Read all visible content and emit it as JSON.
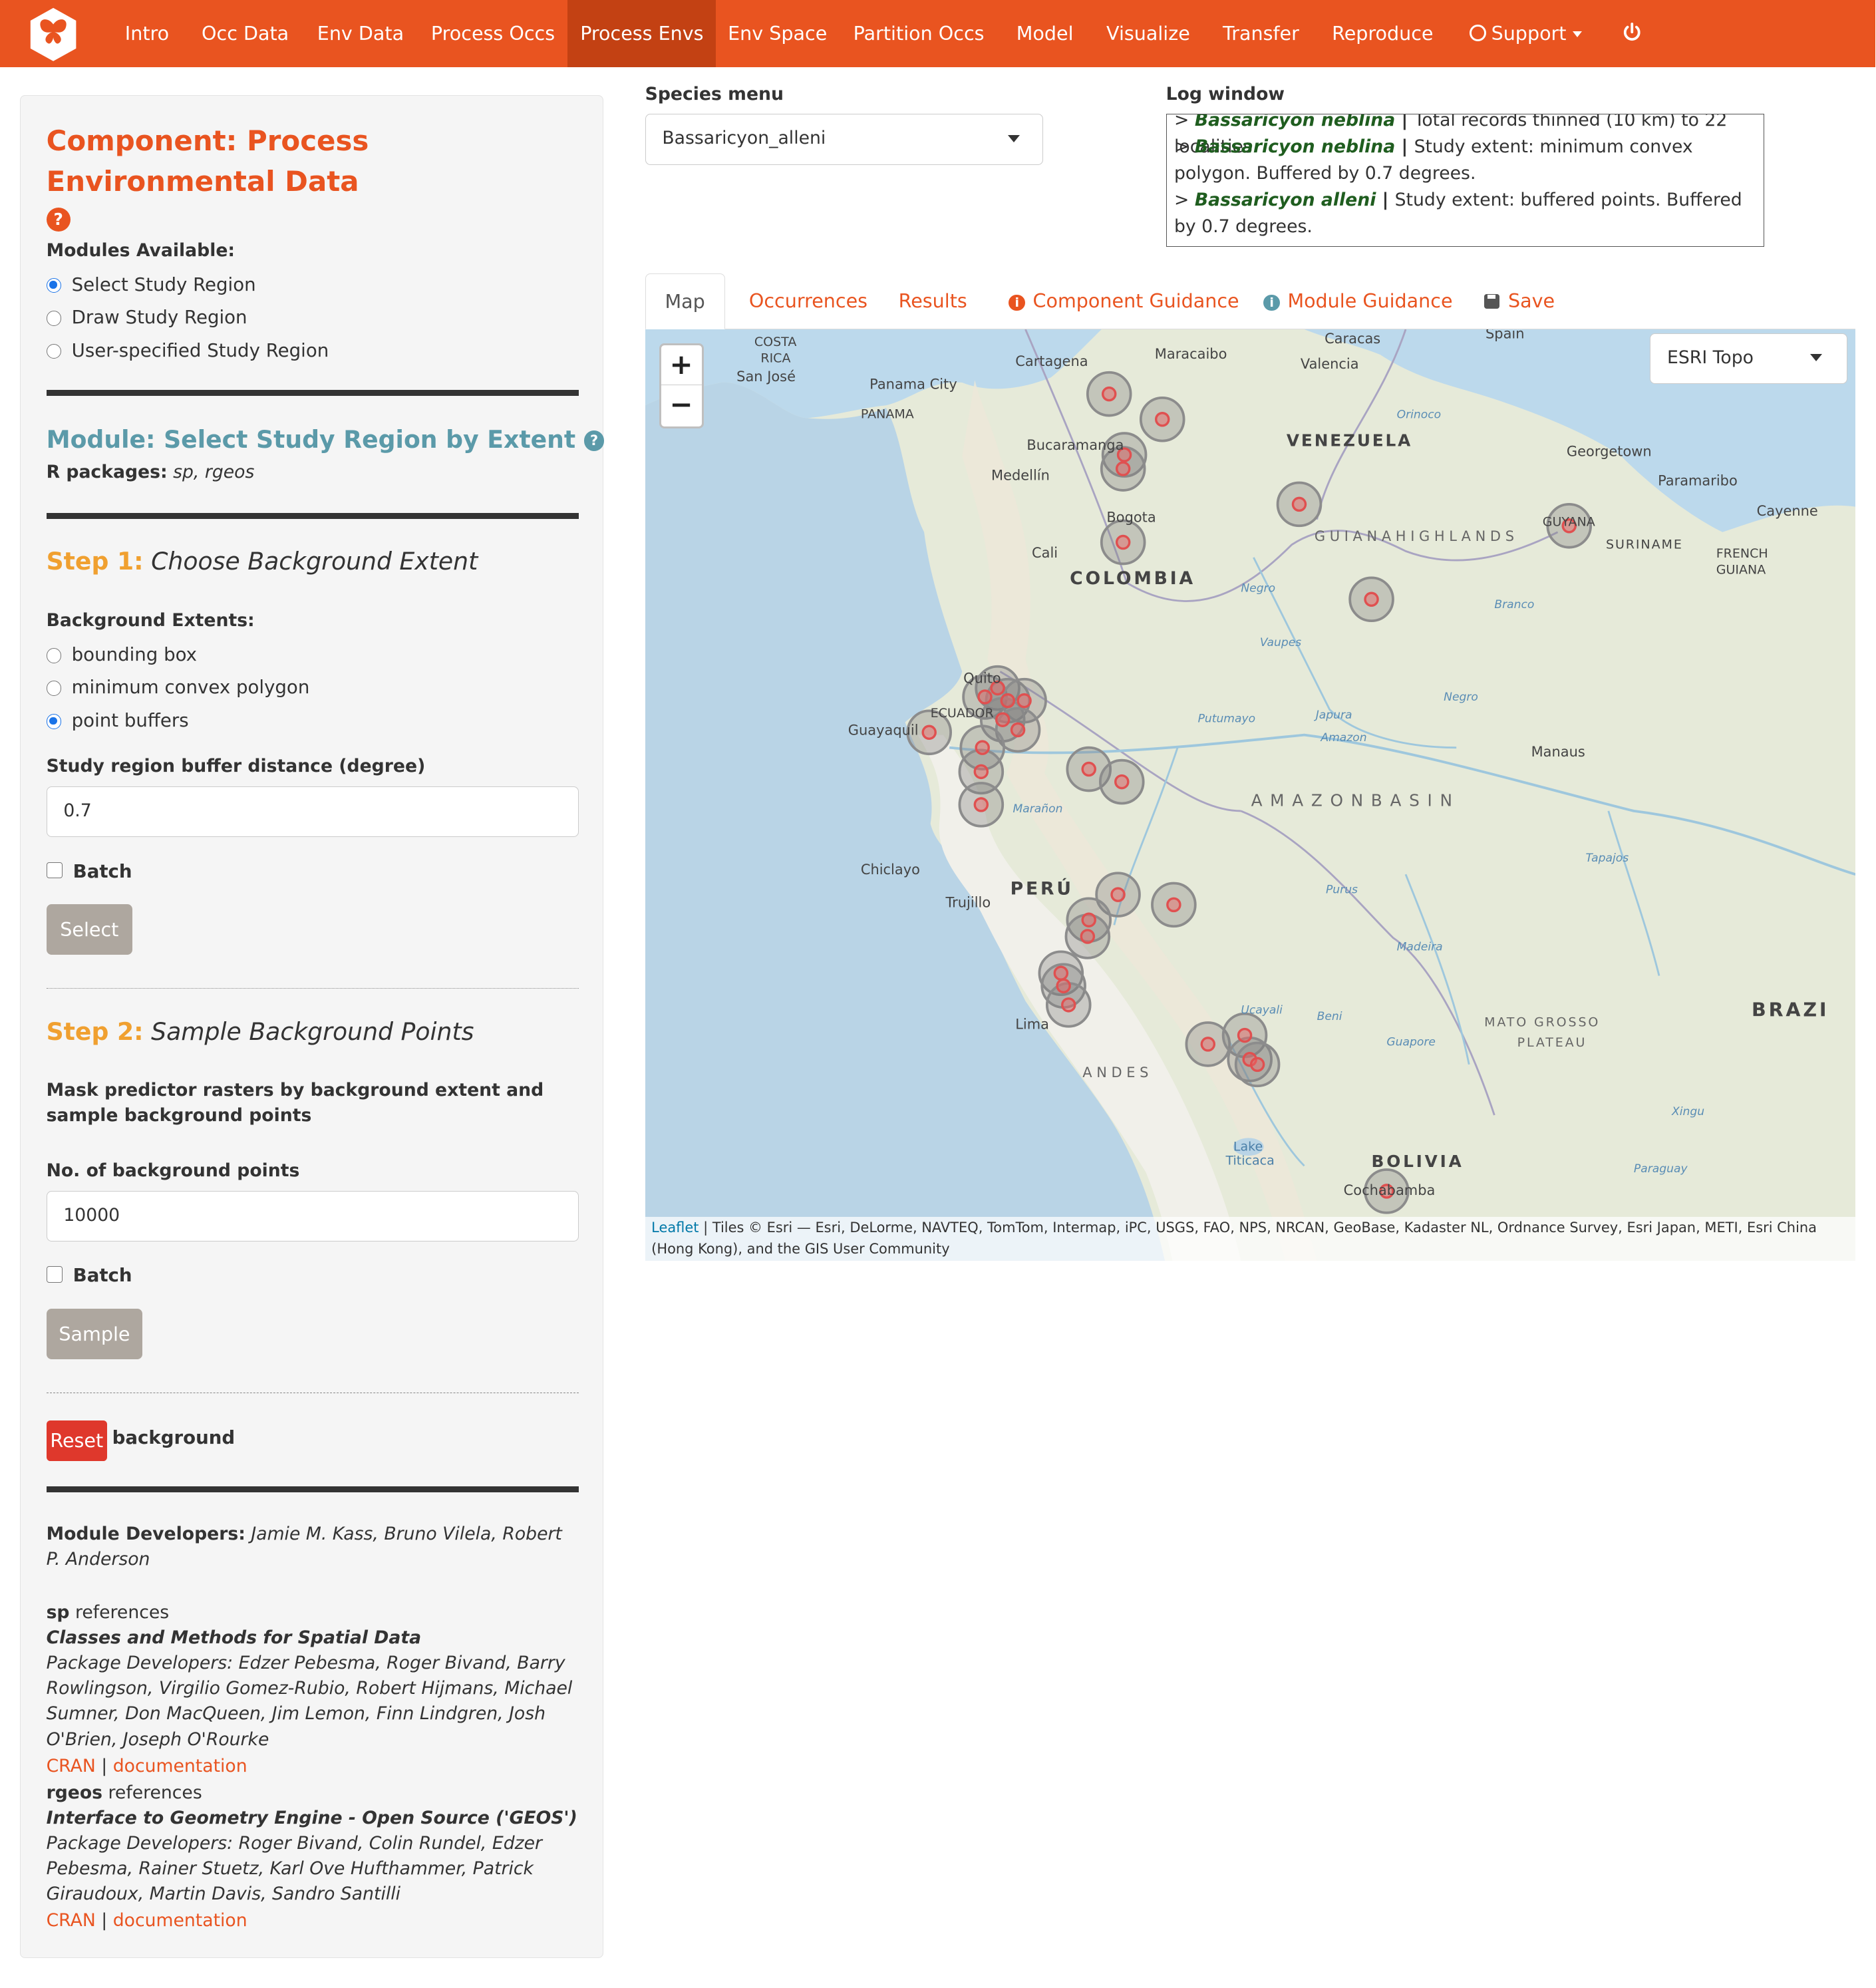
{
  "navbar": {
    "items": [
      "Intro",
      "Occ Data",
      "Env Data",
      "Process Occs",
      "Process Envs",
      "Env Space",
      "Partition Occs",
      "Model",
      "Visualize",
      "Transfer",
      "Reproduce",
      "Support"
    ],
    "active": "Process Envs",
    "brand_color": "#e95420",
    "active_color": "#c34113"
  },
  "sidebar": {
    "component_title": "Component: Process Environmental Data",
    "modules_label": "Modules Available:",
    "modules": [
      {
        "label": "Select Study Region",
        "selected": true
      },
      {
        "label": "Draw Study Region",
        "selected": false
      },
      {
        "label": "User-specified Study Region",
        "selected": false
      }
    ],
    "module_title": "Module: Select Study Region by Extent",
    "r_packages_label": "R packages:",
    "r_packages": "sp, rgeos",
    "step1_num": "Step 1:",
    "step1_title": "Choose Background Extent",
    "extents_label": "Background Extents:",
    "extents": [
      {
        "label": "bounding box",
        "selected": false
      },
      {
        "label": "minimum convex polygon",
        "selected": false
      },
      {
        "label": "point buffers",
        "selected": true
      }
    ],
    "buffer_label": "Study region buffer distance (degree)",
    "buffer_value": "0.7",
    "batch_label": "Batch",
    "select_button": "Select",
    "step2_num": "Step 2:",
    "step2_title": "Sample Background Points",
    "mask_text": "Mask predictor rasters by background extent and sample background points",
    "bg_points_label": "No. of background points",
    "bg_points_value": "10000",
    "batch2_label": "Batch",
    "sample_button": "Sample",
    "reset_button": "Reset",
    "reset_suffix": "background",
    "developers_label": "Module Developers:",
    "developers": "Jamie M. Kass, Bruno Vilela, Robert P. Anderson",
    "refs": [
      {
        "pkg": "sp",
        "suffix": "references",
        "title": "Classes and Methods for Spatial Data",
        "devs": "Package Developers: Edzer Pebesma, Roger Bivand, Barry Rowlingson, Virgilio Gomez-Rubio, Robert Hijmans, Michael Sumner, Don MacQueen, Jim Lemon, Finn Lindgren, Josh O'Brien, Joseph O'Rourke",
        "cran": "CRAN",
        "sep": "|",
        "doc": "documentation"
      },
      {
        "pkg": "rgeos",
        "suffix": "references",
        "title": "Interface to Geometry Engine - Open Source ('GEOS')",
        "devs": "Package Developers: Roger Bivand, Colin Rundel, Edzer Pebesma, Rainer Stuetz, Karl Ove Hufthammer, Patrick Giraudoux, Martin Davis, Sandro Santilli",
        "cran": "CRAN",
        "sep": "|",
        "doc": "documentation"
      }
    ]
  },
  "species_menu": {
    "label": "Species menu",
    "value": "Bassaricyon_alleni"
  },
  "log_window": {
    "label": "Log window",
    "lines": [
      {
        "prefix": "> ",
        "species": "Bassaricyon neblina",
        "bar": " | ",
        "text": "Total records thinned (10 km) to 22 localities"
      },
      {
        "prefix": "> ",
        "species": "Bassaricyon neblina",
        "bar": " | ",
        "text": "Study extent: minimum convex polygon. Buffered by 0.7 degrees."
      },
      {
        "prefix": "> ",
        "species": "Bassaricyon alleni",
        "bar": " | ",
        "text": "Study extent: buffered points. Buffered by 0.7 degrees."
      }
    ]
  },
  "tabs": [
    {
      "label": "Map",
      "icon": "",
      "active": true
    },
    {
      "label": "Occurrences",
      "icon": "",
      "active": false
    },
    {
      "label": "Results",
      "icon": "",
      "active": false
    },
    {
      "label": "Component Guidance",
      "icon": "info-circle-icon",
      "active": false
    },
    {
      "label": "Module Guidance",
      "icon": "info-circle-icon",
      "active": false
    },
    {
      "label": "Save",
      "icon": "floppy-disk-icon",
      "active": false
    }
  ],
  "map": {
    "basemap": "ESRI Topo",
    "zoom_in": "+",
    "zoom_out": "−",
    "attribution_link": "Leaflet",
    "attribution_text": "| Tiles © Esri — Esri, DeLorme, NAVTEQ, TomTom, Intermap, iPC, USGS, FAO, NPS, NRCAN, GeoBase, Kadaster NL, Ordnance Survey, Esri Japan, METI, Esri China (Hong Kong), and the GIS User Community",
    "labels": {
      "costa_rica_1": "COSTA",
      "costa_rica_2": "RICA",
      "san_jose": "San José",
      "panama_city": "Panama City",
      "panama": "PANAMA",
      "cartagena": "Cartagena",
      "maracaibo": "Maracaibo",
      "caracas": "Caracas",
      "valencia": "Valencia",
      "spain": "Spain",
      "venezuela": "VENEZUELA",
      "georgetown": "Georgetown",
      "paramaribo": "Paramaribo",
      "cayenne": "Cayenne",
      "guyana": "GUYANA",
      "suriname": "SURINAME",
      "french_guiana_1": "FRENCH",
      "french_guiana_2": "GUIANA",
      "bucaramanga": "Bucaramanga",
      "medellin": "Medellín",
      "bogota": "Bogota",
      "cali": "Cali",
      "colombia": "COLOMBIA",
      "guiana_highlands": "G U I A N A   H I G H L A N D S",
      "quito": "Quito",
      "ecuador": "ECUADOR",
      "guayaquil": "Guayaquil",
      "manaus": "Manaus",
      "amazon_basin": "A M A Z O N   B A S I N",
      "chiclayo": "Chiclayo",
      "trujillo": "Trujillo",
      "peru": "PERÚ",
      "lima": "Lima",
      "andes": "A N D E S",
      "brazil": "BRAZI",
      "mato_grosso_1": "MATO  GROSSO",
      "mato_grosso_2": "PLATEAU",
      "bolivia": "BOLIVIA",
      "cochabamba": "Cochabamba",
      "lake_titicaca_1": "Lake",
      "lake_titicaca_2": "Titicaca",
      "orinoco": "Orinoco",
      "negro": "Negro",
      "japura": "Japura",
      "amazon": "Amazon",
      "putumayo": "Putumayo",
      "maranon": "Marañon",
      "purus": "Purus",
      "madeira": "Madeira",
      "tapajos": "Tapajos",
      "xingu": "Xingu",
      "guapore": "Guapore",
      "beni": "Beni",
      "ucayali": "Ucayali",
      "vaupes": "Vaupes",
      "branco": "Branco",
      "paraguay": "Paraguay"
    }
  }
}
